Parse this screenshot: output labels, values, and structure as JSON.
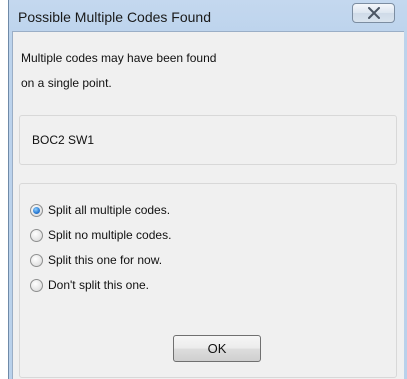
{
  "window": {
    "title": "Possible Multiple Codes Found"
  },
  "message": {
    "line1": "Multiple codes may have been found",
    "line2": "on a single point."
  },
  "code": {
    "value": "BOC2 SW1"
  },
  "options": {
    "selected": "split-all",
    "items": [
      {
        "id": "split-all",
        "label": "Split all multiple codes.",
        "checked": true
      },
      {
        "id": "split-none",
        "label": "Split no multiple codes.",
        "checked": false
      },
      {
        "id": "split-this-for-now",
        "label": "Split this one for now.",
        "checked": false
      },
      {
        "id": "dont-split-this",
        "label": "Don't split this one.",
        "checked": false
      }
    ]
  },
  "buttons": {
    "ok_label": "OK"
  }
}
